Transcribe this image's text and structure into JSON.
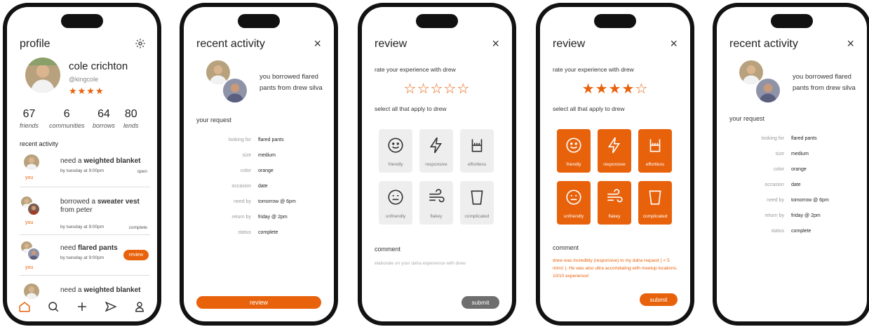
{
  "profile": {
    "title": "profile",
    "name": "cole crichton",
    "handle": "@kingcole",
    "stars": "★★★★",
    "stats": [
      {
        "num": "67",
        "label": "friends"
      },
      {
        "num": "6",
        "label": "communities"
      },
      {
        "num": "64",
        "label": "borrows"
      },
      {
        "num": "80",
        "label": "lends"
      }
    ],
    "recent_heading": "recent activity",
    "activities": [
      {
        "prefix": "need a ",
        "item": "weighted blanket",
        "suffix": "",
        "sub": "by tuesday at 9:00pm",
        "tag": "open",
        "you": "you"
      },
      {
        "prefix": "borrowed a ",
        "item": "sweater vest",
        "suffix": " from peter",
        "sub": "by tuesday at 9:00pm",
        "tag": "complete",
        "you": "you"
      },
      {
        "prefix": "need ",
        "item": "flared pants",
        "suffix": "",
        "sub": "by tuesday at 9:00pm",
        "tag": "review",
        "you": "you"
      },
      {
        "prefix": "need a ",
        "item": "weighted blanket",
        "suffix": "",
        "sub": "",
        "tag": "",
        "you": ""
      }
    ]
  },
  "recent": {
    "title": "recent activity",
    "close": "×",
    "message": "you borrowed flared pants from drew silva",
    "request_heading": "your request",
    "rows": [
      {
        "k": "looking for",
        "v": "flared pants"
      },
      {
        "k": "size",
        "v": "medium"
      },
      {
        "k": "color",
        "v": "orange"
      },
      {
        "k": "occasion",
        "v": "date"
      },
      {
        "k": "need by",
        "v": "tomorrow @ 6pm"
      },
      {
        "k": "return by",
        "v": "friday @ 2pm"
      },
      {
        "k": "status",
        "v": "complete"
      }
    ],
    "button": "review"
  },
  "review": {
    "title": "review",
    "close": "×",
    "rate_prompt": "rate your experience with drew",
    "stars_empty": "☆☆☆☆☆",
    "stars_filled": "★★★★",
    "stars_rest": "☆",
    "select_prompt": "select all that apply to drew",
    "tiles": [
      "friendly",
      "responsive",
      "effortless",
      "unfriendly",
      "flakey",
      "complicated"
    ],
    "comment_heading": "comment",
    "comment_placeholder": "elaborate on your daha experience with drew",
    "comment_text": "drew was incredibly (responsive) to my daha request ( < 5 mins! ). He was also ultra accomdating with meetup locations. 10/10 experience!",
    "submit": "submit",
    "submit_inactive_color": "#6e6e6e",
    "accent": "#e8620c"
  }
}
